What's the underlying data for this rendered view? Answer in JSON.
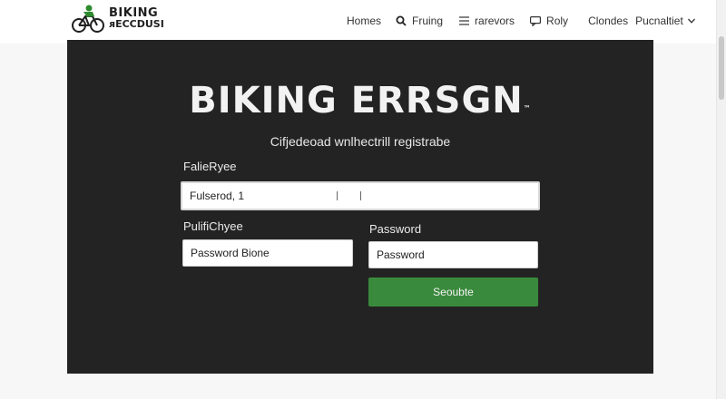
{
  "header": {
    "logo": {
      "line1": "BIKING",
      "line2": "ᴙECCDUSI",
      "icon": "cyclist-icon",
      "accent": "#2e8b2e"
    },
    "nav": [
      {
        "label": "Homes",
        "icon": null
      },
      {
        "label": "Fruing",
        "icon": "search-icon"
      },
      {
        "label": "rarevors",
        "icon": "list-icon"
      },
      {
        "label": "Roly",
        "icon": "chat-icon"
      },
      {
        "label": "Clondes",
        "icon": null
      },
      {
        "label": "Pucnaltiet",
        "icon": "chevron-down-icon"
      }
    ]
  },
  "panel": {
    "brand": "BIKING ERRSGN",
    "brand_tm": "™",
    "subtitle": "Cifjedeoad wnlhectrill registrabe",
    "field1_label": "FalieRyee",
    "field1_value": "Fulserod, 1",
    "field2_label": "PulifiChyee",
    "field2_value": "Password Bione",
    "field3_label": "Password",
    "field3_value": "Password",
    "submit_label": "Seoubte"
  },
  "colors": {
    "panel_bg": "#232323",
    "button_green": "#3a8a3d",
    "page_bg": "#f7f7f7"
  }
}
